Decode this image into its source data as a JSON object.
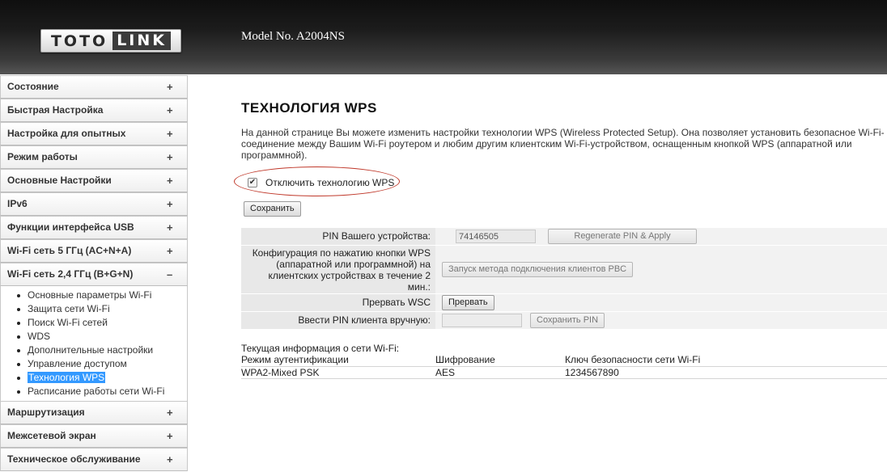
{
  "header": {
    "logo_left": "TOTO",
    "logo_right": "LINK",
    "model": "Model No. A2004NS"
  },
  "sidebar": {
    "items": [
      {
        "label": "Состояние",
        "sign": "+"
      },
      {
        "label": "Быстрая Настройка",
        "sign": "+"
      },
      {
        "label": "Настройка для опытных",
        "sign": "+"
      },
      {
        "label": "Режим работы",
        "sign": "+"
      },
      {
        "label": "Основные Настройки",
        "sign": "+"
      },
      {
        "label": "IPv6",
        "sign": "+"
      },
      {
        "label": "Функции интерфейса USB",
        "sign": "+"
      },
      {
        "label": "Wi-Fi сеть 5 ГГц (AC+N+A)",
        "sign": "+"
      },
      {
        "label": "Wi-Fi сеть 2,4 ГГц (B+G+N)",
        "sign": "–"
      }
    ],
    "submenu": [
      "Основные параметры Wi-Fi",
      "Защита сети Wi-Fi",
      "Поиск Wi-Fi сетей",
      "WDS",
      "Дополнительные настройки",
      "Управление доступом",
      "Технология WPS",
      "Расписание работы сети Wi-Fi"
    ],
    "items_after": [
      {
        "label": "Маршрутизация",
        "sign": "+"
      },
      {
        "label": "Межсетевой экран",
        "sign": "+"
      },
      {
        "label": "Техническое обслуживание",
        "sign": "+"
      }
    ]
  },
  "main": {
    "title": "ТЕХНОЛОГИЯ WPS",
    "description": "На данной странице Вы можете изменить настройки технологии WPS (Wireless Protected Setup). Она позволяет установить безопасное Wi-Fi-соединение между Вашим Wi-Fi роутером и любим другим клиентским Wi-Fi-устройством, оснащенным кнопкой WPS (аппаратной или программной).",
    "disable_wps_label": "Отключить технологию WPS",
    "disable_wps_checked": true,
    "save_label": "Сохранить"
  },
  "config": {
    "pin_label": "PIN Вашего устройства:",
    "pin_value": "74146505",
    "regen_label": "Regenerate PIN & Apply",
    "pbc_label": "Конфигурация по нажатию кнопки WPS (аппаратной или программной) на клиентских устройствах в течение 2 мин.:",
    "pbc_button": "Запуск метода подключения клиентов PBC",
    "abort_label": "Прервать WSC",
    "abort_button": "Прервать",
    "client_pin_label": "Ввести PIN клиента вручную:",
    "client_pin_value": "",
    "save_pin_button": "Сохранить PIN"
  },
  "info": {
    "caption": "Текущая информация о сети Wi-Fi:",
    "headers": [
      "Режим аутентификации",
      "Шифрование",
      "Ключ безопасности сети Wi-Fi"
    ],
    "row": [
      "WPA2-Mixed PSK",
      "AES",
      "1234567890"
    ]
  }
}
